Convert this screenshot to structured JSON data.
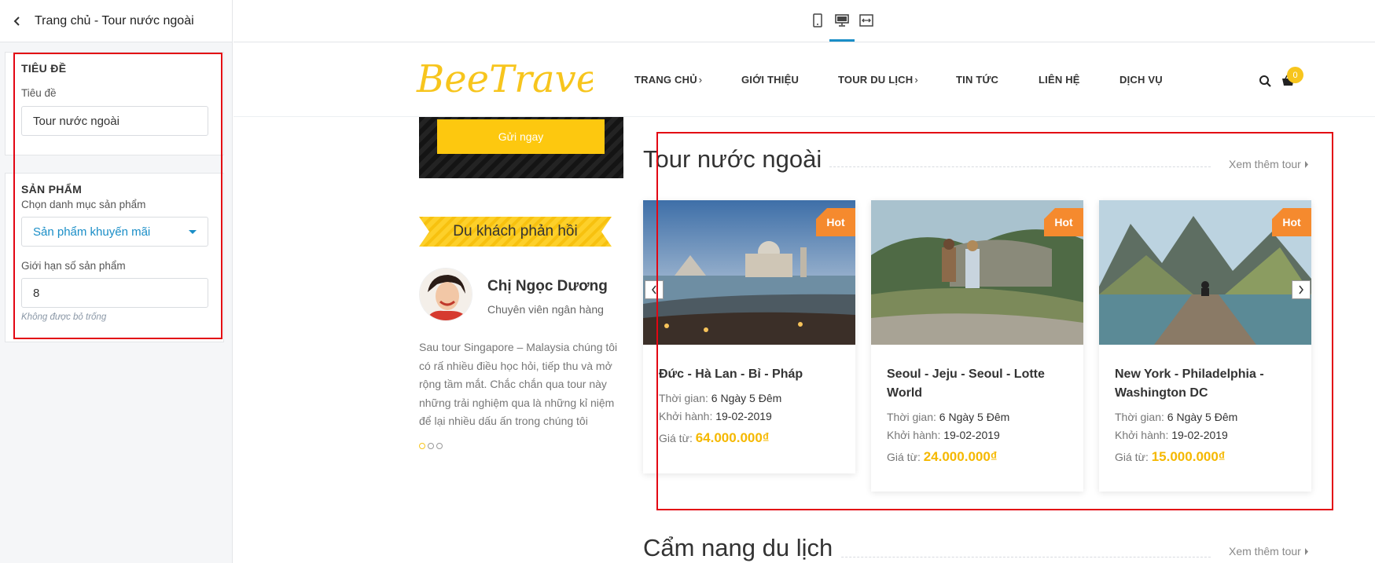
{
  "editor": {
    "title": "Trang chủ - Tour nước ngoài",
    "title_section": {
      "heading": "TIÊU ĐỀ",
      "field_label": "Tiêu đề",
      "field_value": "Tour nước ngoài"
    },
    "product_section": {
      "heading": "SẢN PHẨM",
      "category_label": "Chọn danh mục sản phẩm",
      "category_value": "Sản phẩm khuyến mãi",
      "limit_label": "Giới hạn số sản phẩm",
      "limit_value": "8",
      "limit_hint": "Không được bỏ trống"
    }
  },
  "device_toolbar": {
    "devices": [
      "mobile-icon",
      "desktop-icon",
      "fullwidth-icon"
    ],
    "active": "desktop-icon",
    "accent": "#1a8ec7"
  },
  "site": {
    "logo_text": "BeeTravel",
    "nav": [
      "TRANG CHỦ",
      "GIỚI THIỆU",
      "TOUR DU LỊCH",
      "TIN TỨC",
      "LIÊN HỆ",
      "DỊCH VỤ"
    ],
    "cart_count": "0",
    "brand_color": "#fdc80f",
    "send_button": "Gửi ngay",
    "testimonial": {
      "ribbon": "Du khách phản hồi",
      "name": "Chị Ngọc Dương",
      "role": "Chuyên viên ngân hàng",
      "text": "Sau tour Singapore – Malaysia chúng tôi có rấ nhiều điều học hỏi, tiếp thu và mở rộng tầm mắt. Chắc chắn qua tour này những trải nghiệm qua là những kỉ niệm để lại nhiều dấu ấn trong chúng tôi"
    },
    "tour_section": {
      "heading": "Tour nước ngoài",
      "see_more": "Xem thêm tour",
      "badge": "Hot",
      "duration_label": "Thời gian:",
      "depart_label": "Khởi hành:",
      "price_label": "Giá từ:",
      "tours": [
        {
          "name": "Đức - Hà Lan - Bỉ - Pháp",
          "duration": "6 Ngày 5 Đêm",
          "depart": "19-02-2019",
          "price": "64.000.000₫"
        },
        {
          "name": "Seoul - Jeju - Seoul - Lotte World",
          "duration": "6 Ngày 5 Đêm",
          "depart": "19-02-2019",
          "price": "24.000.000₫"
        },
        {
          "name": "New York - Philadelphia - Washington DC",
          "duration": "6 Ngày 5 Đêm",
          "depart": "19-02-2019",
          "price": "15.000.000₫"
        }
      ]
    },
    "guide_section": {
      "heading": "Cẩm nang du lịch",
      "see_more": "Xem thêm tour"
    }
  }
}
